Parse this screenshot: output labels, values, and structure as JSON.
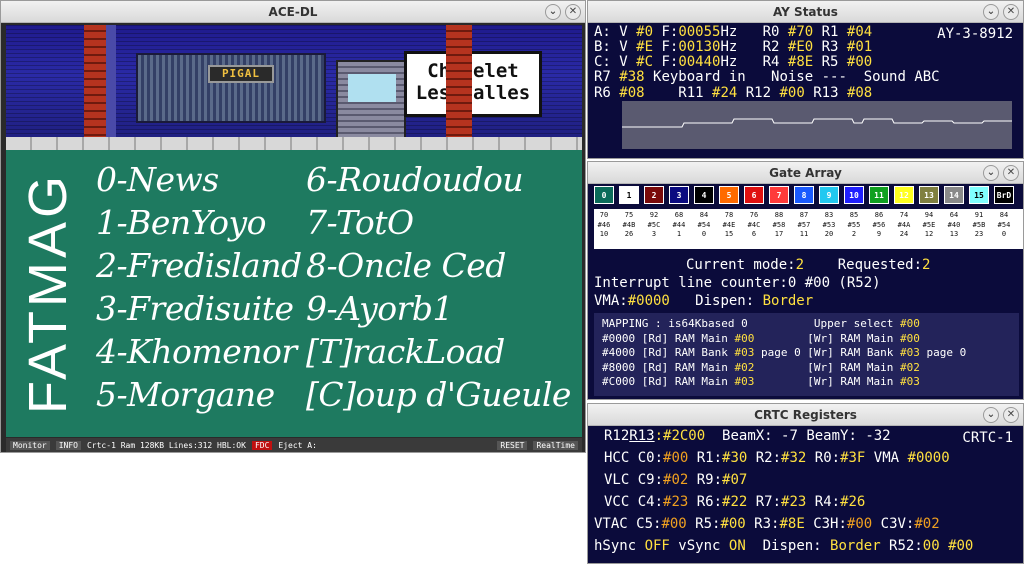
{
  "ace": {
    "title": "ACE-DL",
    "scene": {
      "shop_sign": "PIGAL",
      "metro_line1": "Chatelet",
      "metro_line2": "Les Halles"
    },
    "logo": "FATMAG",
    "menu": [
      "0-News",
      "1-BenYoyo",
      "2-Fredisland",
      "3-Fredisuite",
      "4-Khomenor",
      "5-Morgane",
      "6-Roudoudou",
      "7-TotO",
      "8-Oncle Ced",
      "9-Ayorb1",
      "[T]rackLoad",
      "[C]oup d'Gueule"
    ],
    "status": {
      "monitor": "Monitor",
      "info": "INFO",
      "text": "Crtc-1 Ram 128KB Lines:312 HBL:OK",
      "fdc": "FDC",
      "eject": "Eject A:",
      "reset": "RESET",
      "realtime": "RealTime"
    }
  },
  "ay": {
    "title": "AY Status",
    "chip": "AY-3-8912",
    "lines": [
      [
        "A: V ",
        "#0",
        " F:",
        "00055",
        "Hz   R0 ",
        "#70",
        " R1 ",
        "#04"
      ],
      [
        "B: V ",
        "#E",
        " F:",
        "00130",
        "Hz   R2 ",
        "#E0",
        " R3 ",
        "#01"
      ],
      [
        "C: V ",
        "#C",
        " F:",
        "00440",
        "Hz   R4 ",
        "#8E",
        " R5 ",
        "#00"
      ]
    ],
    "line4": [
      "R7 ",
      "#38",
      " Keyboard in   Noise ---  Sound ABC"
    ],
    "line5": [
      "R6 ",
      "#08",
      "    R11 ",
      "#24",
      " R12 ",
      "#00",
      " R13 ",
      "#08"
    ]
  },
  "ga": {
    "title": "Gate Array",
    "palette": [
      {
        "n": "0",
        "c": "#0b6b5a",
        "t": "#ffffff"
      },
      {
        "n": "1",
        "c": "#ffffff",
        "t": "#000000"
      },
      {
        "n": "2",
        "c": "#7a0a0a",
        "t": "#ffffff"
      },
      {
        "n": "3",
        "c": "#0a0a80",
        "t": "#ffffff"
      },
      {
        "n": "4",
        "c": "#000000",
        "t": "#ffffff"
      },
      {
        "n": "5",
        "c": "#ff6a00",
        "t": "#ffffff"
      },
      {
        "n": "6",
        "c": "#e01010",
        "t": "#ffffff"
      },
      {
        "n": "7",
        "c": "#ff3a3a",
        "t": "#ffffff"
      },
      {
        "n": "8",
        "c": "#1a5aff",
        "t": "#ffffff"
      },
      {
        "n": "9",
        "c": "#22c8f0",
        "t": "#ffffff"
      },
      {
        "n": "10",
        "c": "#2020ff",
        "t": "#ffffff"
      },
      {
        "n": "11",
        "c": "#10a020",
        "t": "#ffffff"
      },
      {
        "n": "12",
        "c": "#ffff20",
        "t": "#ffffff"
      },
      {
        "n": "13",
        "c": "#808040",
        "t": "#ffffff"
      },
      {
        "n": "14",
        "c": "#8a8a8a",
        "t": "#ffffff"
      },
      {
        "n": "15",
        "c": "#80ffff",
        "t": "#000000"
      },
      {
        "n": "BrD",
        "c": "#000000",
        "t": "#ffffff"
      }
    ],
    "palinfo": [
      [
        "70",
        "#46",
        "10"
      ],
      [
        "75",
        "#4B",
        "26"
      ],
      [
        "92",
        "#5C",
        "3"
      ],
      [
        "68",
        "#44",
        "1"
      ],
      [
        "84",
        "#54",
        "0"
      ],
      [
        "78",
        "#4E",
        "15"
      ],
      [
        "76",
        "#4C",
        "6"
      ],
      [
        "88",
        "#58",
        "17"
      ],
      [
        "87",
        "#57",
        "11"
      ],
      [
        "83",
        "#53",
        "20"
      ],
      [
        "85",
        "#55",
        "2"
      ],
      [
        "86",
        "#56",
        "9"
      ],
      [
        "74",
        "#4A",
        "24"
      ],
      [
        "94",
        "#5E",
        "12"
      ],
      [
        "64",
        "#40",
        "13"
      ],
      [
        "91",
        "#5B",
        "23"
      ],
      [
        "84",
        "#54",
        "0"
      ]
    ],
    "mode": [
      "Current mode:",
      "2",
      "    Requested:",
      "2"
    ],
    "interrupt": "Interrupt line counter:0 #00 (R52)",
    "vma": [
      "VMA:",
      "#0000",
      "   Dispen: ",
      "Border"
    ],
    "mapping_header": [
      "MAPPING : is64Kbased 0          Upper select ",
      "#00"
    ],
    "mapping": [
      [
        "#0000 [Rd] RAM Main ",
        "#00",
        "        [Wr] RAM Main ",
        "#00",
        ""
      ],
      [
        "#4000 [Rd] RAM Bank ",
        "#03",
        " page 0 [Wr] RAM Bank ",
        "#03",
        " page 0"
      ],
      [
        "#8000 [Rd] RAM Main ",
        "#02",
        "        [Wr] RAM Main ",
        "#02",
        ""
      ],
      [
        "#C000 [Rd] RAM Main ",
        "#03",
        "        [Wr] RAM Main ",
        "#03",
        ""
      ]
    ]
  },
  "crtc": {
    "title": "CRTC Registers",
    "chip": "CRTC-1",
    "r12": "R12",
    "r13": "R13",
    "r1213": ":#2C00",
    "beam": "  BeamX: -7 BeamY: -32",
    "l2": [
      "HCC C0:",
      "#00",
      " R1:",
      "#30",
      " R2:",
      "#32",
      " R0:",
      "#3F",
      " VMA ",
      "#0000"
    ],
    "l3": [
      "VLC C9:",
      "#02",
      " R9:",
      "#07"
    ],
    "l4": [
      "VCC C4:",
      "#23",
      " R6:",
      "#22",
      " R7:",
      "#23",
      " R4:",
      "#26"
    ],
    "l5": [
      "VTAC C5:",
      "#00",
      " R5:",
      "#00",
      " R3:",
      "#8E",
      " C3H:",
      "#00",
      " C3V:",
      "#02"
    ],
    "l6": [
      "hSync ",
      "OFF",
      " vSync ",
      "ON",
      "  Dispen: ",
      "Border",
      " R52:",
      "00 #00"
    ]
  }
}
